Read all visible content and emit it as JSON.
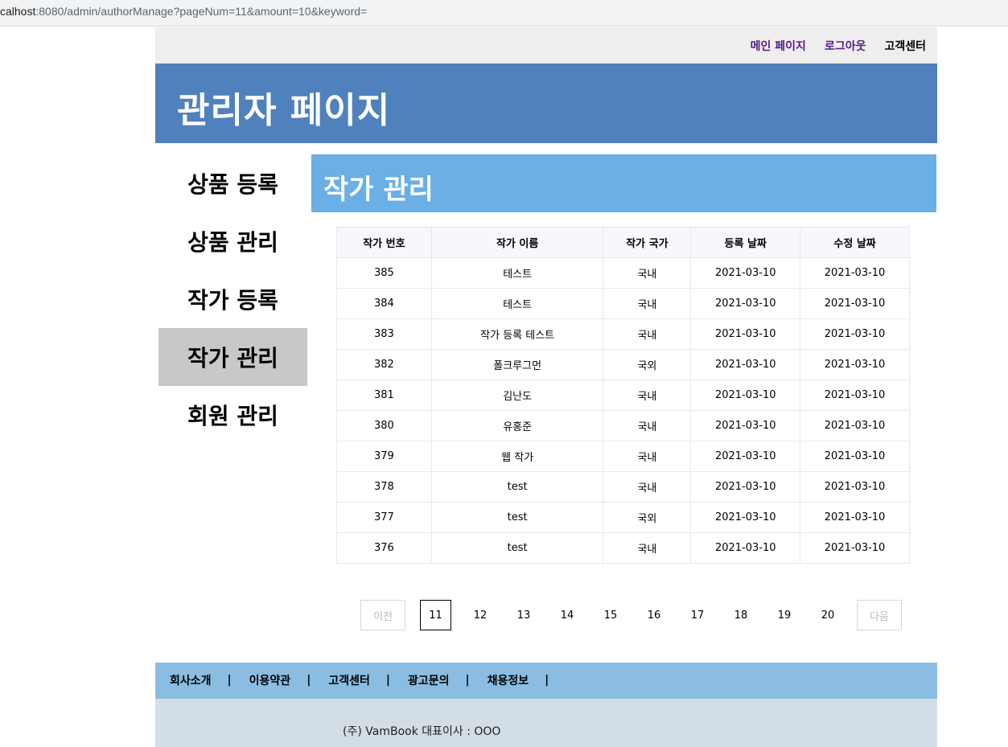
{
  "browser": {
    "url_prefix": "calhost",
    "url_rest": ":8080/admin/authorManage?pageNum=11&amount=10&keyword="
  },
  "top_nav": {
    "main_page": "메인 페이지",
    "logout": "로그아웃",
    "customer_center": "고객센터"
  },
  "header": {
    "title": "관리자 페이지"
  },
  "sidebar": {
    "items": [
      {
        "label": "상품 등록",
        "active": false
      },
      {
        "label": "상품 관리",
        "active": false
      },
      {
        "label": "작가 등록",
        "active": false
      },
      {
        "label": "작가 관리",
        "active": true
      },
      {
        "label": "회원 관리",
        "active": false
      }
    ]
  },
  "content": {
    "title": "작가 관리"
  },
  "table": {
    "headers": [
      "작가 번호",
      "작가 이름",
      "작가 국가",
      "등록 날짜",
      "수정 날짜"
    ],
    "rows": [
      [
        "385",
        "테스트",
        "국내",
        "2021-03-10",
        "2021-03-10"
      ],
      [
        "384",
        "테스트",
        "국내",
        "2021-03-10",
        "2021-03-10"
      ],
      [
        "383",
        "작가 등록 테스트",
        "국내",
        "2021-03-10",
        "2021-03-10"
      ],
      [
        "382",
        "폴크루그먼",
        "국외",
        "2021-03-10",
        "2021-03-10"
      ],
      [
        "381",
        "김난도",
        "국내",
        "2021-03-10",
        "2021-03-10"
      ],
      [
        "380",
        "유홍준",
        "국내",
        "2021-03-10",
        "2021-03-10"
      ],
      [
        "379",
        "웹 작가",
        "국내",
        "2021-03-10",
        "2021-03-10"
      ],
      [
        "378",
        "test",
        "국내",
        "2021-03-10",
        "2021-03-10"
      ],
      [
        "377",
        "test",
        "국외",
        "2021-03-10",
        "2021-03-10"
      ],
      [
        "376",
        "test",
        "국내",
        "2021-03-10",
        "2021-03-10"
      ]
    ]
  },
  "pagination": {
    "prev": "이전",
    "next": "다음",
    "current": "11",
    "pages": [
      "11",
      "12",
      "13",
      "14",
      "15",
      "16",
      "17",
      "18",
      "19",
      "20"
    ]
  },
  "footer": {
    "links": [
      "회사소개",
      "이용약관",
      "고객센터",
      "광고문의",
      "채용정보"
    ],
    "separator": "|",
    "company": "(주) VamBook 대표이사 : OOO"
  }
}
